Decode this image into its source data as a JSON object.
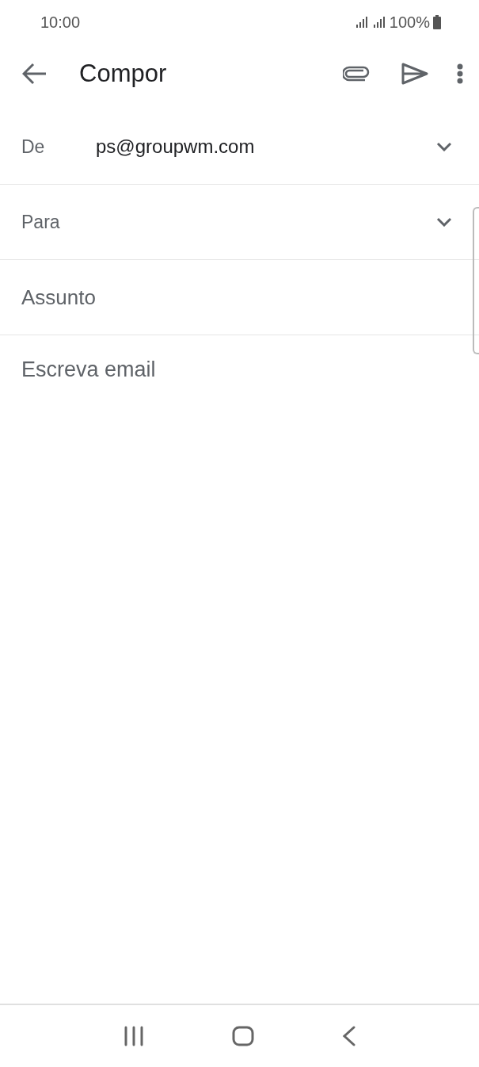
{
  "status_bar": {
    "time": "10:00",
    "battery": "100%"
  },
  "app_bar": {
    "title": "Compor"
  },
  "fields": [
    {
      "label": "De",
      "value": "ps@groupwm.com",
      "kind": "dropdown"
    },
    {
      "label": "Para",
      "kind": "dropdown"
    },
    {
      "placeholder": "Assunto",
      "kind": "text"
    }
  ],
  "body": {
    "placeholder": "Escreva email"
  }
}
